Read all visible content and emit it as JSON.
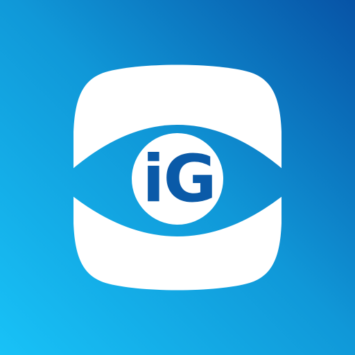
{
  "app_icon": {
    "logo_text": "iG",
    "icon_name": "eye-icon",
    "colors": {
      "gradient_start": "#18C2F7",
      "gradient_mid": "#1098D8",
      "gradient_end": "#0753A6",
      "shape": "#FFFFFF",
      "text": "#0A5AA8"
    }
  }
}
